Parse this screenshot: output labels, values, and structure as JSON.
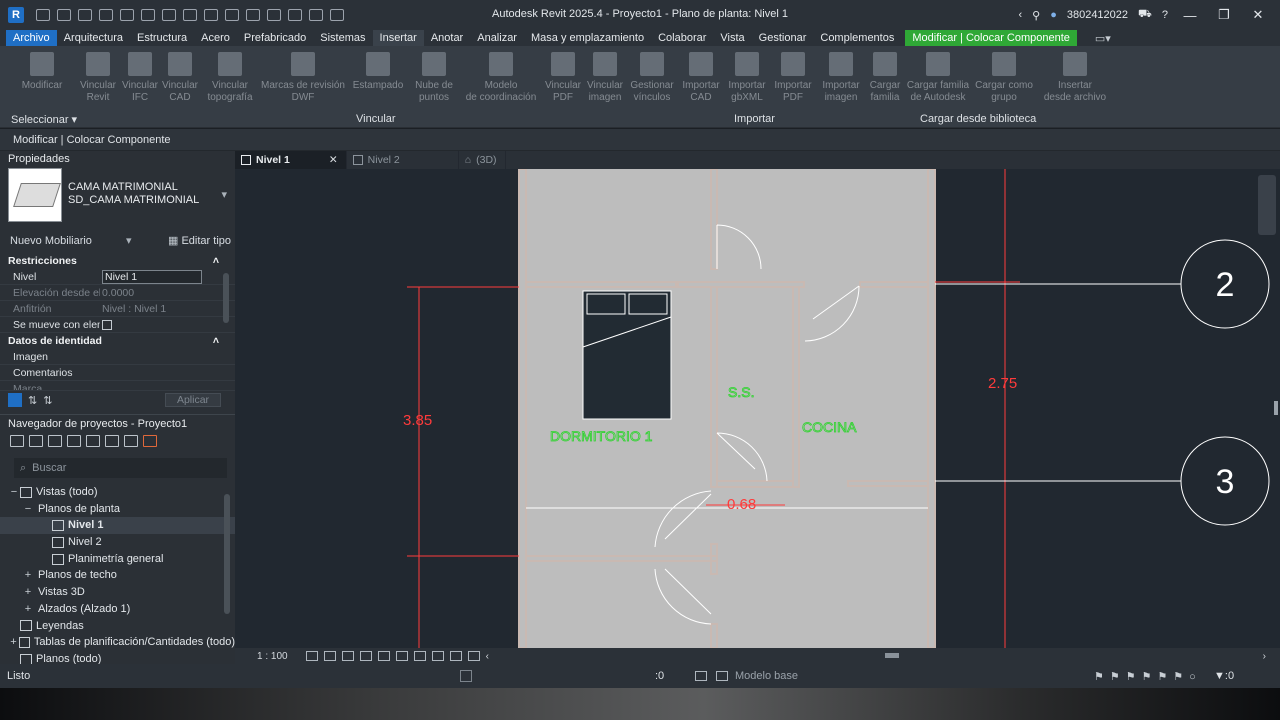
{
  "app": {
    "logo": "R",
    "title": "Autodesk Revit 2025.4 - Proyecto1 - Plano de planta: Nivel 1",
    "user": "3802412022"
  },
  "menu": {
    "file": "Archivo",
    "items": [
      "Arquitectura",
      "Estructura",
      "Acero",
      "Prefabricado",
      "Sistemas",
      "Insertar",
      "Anotar",
      "Analizar",
      "Masa y emplazamiento",
      "Colaborar",
      "Vista",
      "Gestionar",
      "Complementos"
    ],
    "active": "Insertar",
    "contextual": "Modificar | Colocar Componente"
  },
  "ribbon": {
    "buttons": [
      {
        "label": "Modificar"
      },
      {
        "label": "Vincular\nRevit"
      },
      {
        "label": "Vincular\nIFC"
      },
      {
        "label": "Vincular\nCAD"
      },
      {
        "label": "Vincular\ntopografía"
      },
      {
        "label": "Marcas de revisión\nDWF"
      },
      {
        "label": "Estampado"
      },
      {
        "label": "Nube de\npuntos"
      },
      {
        "label": "Modelo\nde coordinación"
      },
      {
        "label": "Vincular\nPDF"
      },
      {
        "label": "Vincular\nimagen"
      },
      {
        "label": "Gestionar\nvínculos"
      },
      {
        "label": "Importar\nCAD"
      },
      {
        "label": "Importar\ngbXML"
      },
      {
        "label": "Importar\nPDF"
      },
      {
        "label": "Importar\nimagen"
      },
      {
        "label": "Cargar\nfamilia"
      },
      {
        "label": "Cargar familia\nde Autodesk"
      },
      {
        "label": "Cargar como\ngrupo"
      },
      {
        "label": "Insertar\ndesde archivo"
      }
    ],
    "panels": [
      "Seleccionar",
      "Vincular",
      "Importar",
      "Cargar desde biblioteca"
    ]
  },
  "options_bar": "Modificar | Colocar Componente",
  "properties": {
    "title": "Propiedades",
    "type_name_1": "CAMA MATRIMONIAL",
    "type_name_2": "SD_CAMA MATRIMONIAL",
    "instance_filter": "Nuevo Mobiliario",
    "edit_type": "Editar tipo",
    "group_constraints": "Restricciones",
    "level_label": "Nivel",
    "level_value": "Nivel 1",
    "elevation_label": "Elevación desde el ...",
    "elevation_value": "0.0000",
    "host_label": "Anfitrión",
    "host_value": "Nivel : Nivel 1",
    "moves_label": "Se mueve con elem...",
    "group_identity": "Datos de identidad",
    "image_label": "Imagen",
    "comments_label": "Comentarios",
    "mark_label": "Marca",
    "apply": "Aplicar"
  },
  "browser": {
    "title": "Navegador de proyectos - Proyecto1",
    "search_placeholder": "Buscar",
    "rows": [
      {
        "text": "Vistas (todo)"
      },
      {
        "text": "Planos de planta"
      },
      {
        "text": "Nivel 1"
      },
      {
        "text": "Nivel 2"
      },
      {
        "text": "Planimetría general"
      },
      {
        "text": "Planos de techo"
      },
      {
        "text": "Vistas 3D"
      },
      {
        "text": "Alzados (Alzado 1)"
      },
      {
        "text": "Leyendas"
      },
      {
        "text": "Tablas de planificación/Cantidades (todo)"
      },
      {
        "text": "Planos (todo)"
      }
    ]
  },
  "view_tabs": [
    {
      "label": "Nivel 1"
    },
    {
      "label": "Nivel 2"
    },
    {
      "label": "(3D)"
    }
  ],
  "drawing": {
    "rooms": {
      "dormitorio": "DORMITORIO 1",
      "ss": "S.S.",
      "cocina": "COCINA"
    },
    "dims": {
      "d1": "3.85",
      "d2": "2.75",
      "d3": "0.68"
    },
    "grids": {
      "g2": "2",
      "g3": "3"
    },
    "colors": {
      "wall": "#c9b9b2",
      "dim": "#ff3b3b",
      "room_text": "#2fd42f",
      "floor": "#bdbdbd",
      "bg": "#212830"
    }
  },
  "view_bar": {
    "scale": "1 : 100"
  },
  "status": {
    "text": "Listo",
    "zero_1": ":0",
    "model": "Modelo base",
    "zero_2": ":0"
  }
}
